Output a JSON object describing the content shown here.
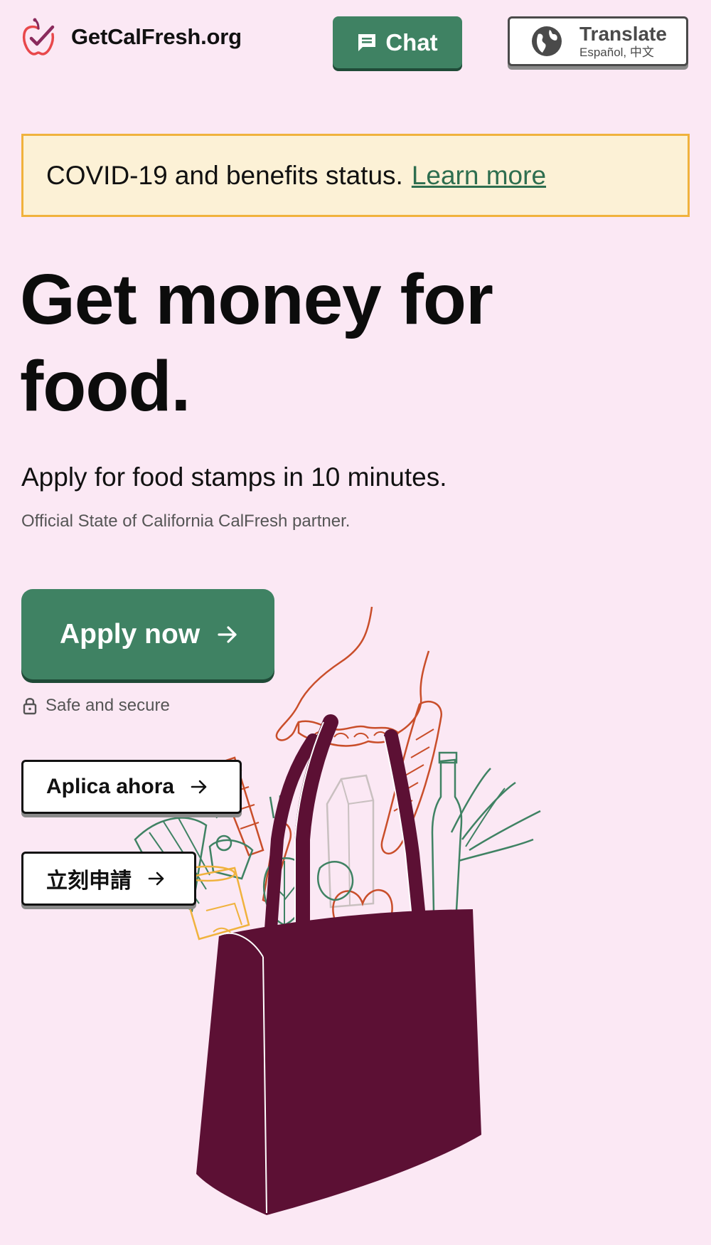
{
  "header": {
    "logo_text": "GetCalFresh.org",
    "chat_label": "Chat",
    "translate_title": "Translate",
    "translate_sub": "Español, 中文"
  },
  "banner": {
    "text": "COVID-19 and benefits status.",
    "link": "Learn more"
  },
  "hero": {
    "title": "Get money for food.",
    "subtitle": "Apply for food stamps in 10 minutes.",
    "note": "Official State of California CalFresh partner."
  },
  "actions": {
    "apply_label": "Apply now",
    "secure_label": "Safe and secure",
    "spanish_label": "Aplica ahora",
    "chinese_label": "立刻申請"
  },
  "colors": {
    "background": "#fbe8f4",
    "primary_green": "#3f8263",
    "banner_bg": "#fcf1d6",
    "banner_border": "#f0b23d",
    "bag": "#5c1034"
  },
  "icons": [
    "apple-check-logo-icon",
    "chat-bubble-icon",
    "globe-icon",
    "arrow-right-icon",
    "lock-icon"
  ]
}
